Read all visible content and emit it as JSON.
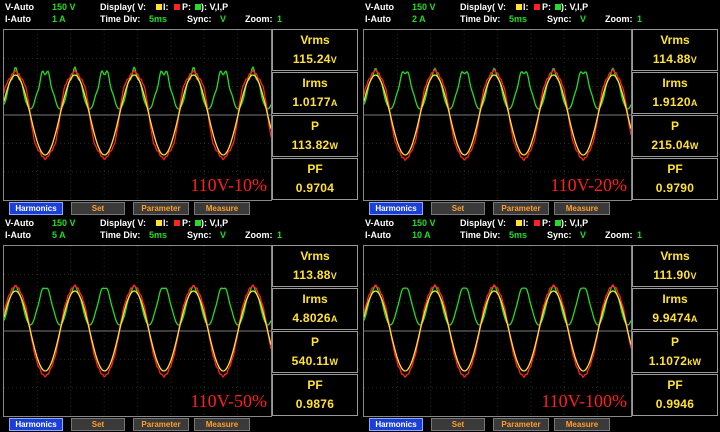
{
  "panels": [
    {
      "header": {
        "v_mode": "V-Auto",
        "v_range": "150 V",
        "i_mode": "I-Auto",
        "i_range": "1 A",
        "display_label": "Display( V:",
        "i_label": "I:",
        "p_label": "P:",
        "display_end": "): V,I,P",
        "time_div_label": "Time Div:",
        "time_div": "5ms",
        "sync_label": "Sync:",
        "sync": "V",
        "zoom_label": "Zoom:",
        "zoom": "1"
      },
      "tag": "110V-10%",
      "readings": {
        "vrms_label": "Vrms",
        "vrms": "115.24",
        "vrms_unit": "V",
        "irms_label": "Irms",
        "irms": "1.0177",
        "irms_unit": "A",
        "p_label": "P",
        "p": "113.82",
        "p_unit": "W",
        "pf_label": "PF",
        "pf": "0.9704"
      },
      "buttons": {
        "harmonics": "Harmonics",
        "set": "Set",
        "parameter": "Parameter",
        "measure": "Measure"
      }
    },
    {
      "header": {
        "v_mode": "V-Auto",
        "v_range": "150 V",
        "i_mode": "I-Auto",
        "i_range": "2 A",
        "display_label": "Display( V:",
        "i_label": "I:",
        "p_label": "P:",
        "display_end": "): V,I,P",
        "time_div_label": "Time Div:",
        "time_div": "5ms",
        "sync_label": "Sync:",
        "sync": "V",
        "zoom_label": "Zoom:",
        "zoom": "1"
      },
      "tag": "110V-20%",
      "readings": {
        "vrms_label": "Vrms",
        "vrms": "114.88",
        "vrms_unit": "V",
        "irms_label": "Irms",
        "irms": "1.9120",
        "irms_unit": "A",
        "p_label": "P",
        "p": "215.04",
        "p_unit": "W",
        "pf_label": "PF",
        "pf": "0.9790"
      },
      "buttons": {
        "harmonics": "Harmonics",
        "set": "Set",
        "parameter": "Parameter",
        "measure": "Measure"
      }
    },
    {
      "header": {
        "v_mode": "V-Auto",
        "v_range": "150 V",
        "i_mode": "I-Auto",
        "i_range": "5 A",
        "display_label": "Display( V:",
        "i_label": "I:",
        "p_label": "P:",
        "display_end": "): V,I,P",
        "time_div_label": "Time Div:",
        "time_div": "5ms",
        "sync_label": "Sync:",
        "sync": "V",
        "zoom_label": "Zoom:",
        "zoom": "1"
      },
      "tag": "110V-50%",
      "readings": {
        "vrms_label": "Vrms",
        "vrms": "113.88",
        "vrms_unit": "V",
        "irms_label": "Irms",
        "irms": "4.8026",
        "irms_unit": "A",
        "p_label": "P",
        "p": "540.11",
        "p_unit": "W",
        "pf_label": "PF",
        "pf": "0.9876"
      },
      "buttons": {
        "harmonics": "Harmonics",
        "set": "Set",
        "parameter": "Parameter",
        "measure": "Measure"
      }
    },
    {
      "header": {
        "v_mode": "V-Auto",
        "v_range": "150 V",
        "i_mode": "I-Auto",
        "i_range": "10 A",
        "display_label": "Display( V:",
        "i_label": "I:",
        "p_label": "P:",
        "display_end": "): V,I,P",
        "time_div_label": "Time Div:",
        "time_div": "5ms",
        "sync_label": "Sync:",
        "sync": "V",
        "zoom_label": "Zoom:",
        "zoom": "1"
      },
      "tag": "110V-100%",
      "readings": {
        "vrms_label": "Vrms",
        "vrms": "111.90",
        "vrms_unit": "V",
        "irms_label": "Irms",
        "irms": "9.9474",
        "irms_unit": "A",
        "p_label": "P",
        "p": "1.1072",
        "p_unit": "kW",
        "pf_label": "PF",
        "pf": "0.9946"
      },
      "buttons": {
        "harmonics": "Harmonics",
        "set": "Set",
        "parameter": "Parameter",
        "measure": "Measure"
      }
    }
  ],
  "colors": {
    "voltage": "#ffe233",
    "current": "#ff2222",
    "power": "#22dd22",
    "readout": "#ffe233",
    "tag": "#ff1e1e",
    "active_button": "#1a3fd6"
  }
}
